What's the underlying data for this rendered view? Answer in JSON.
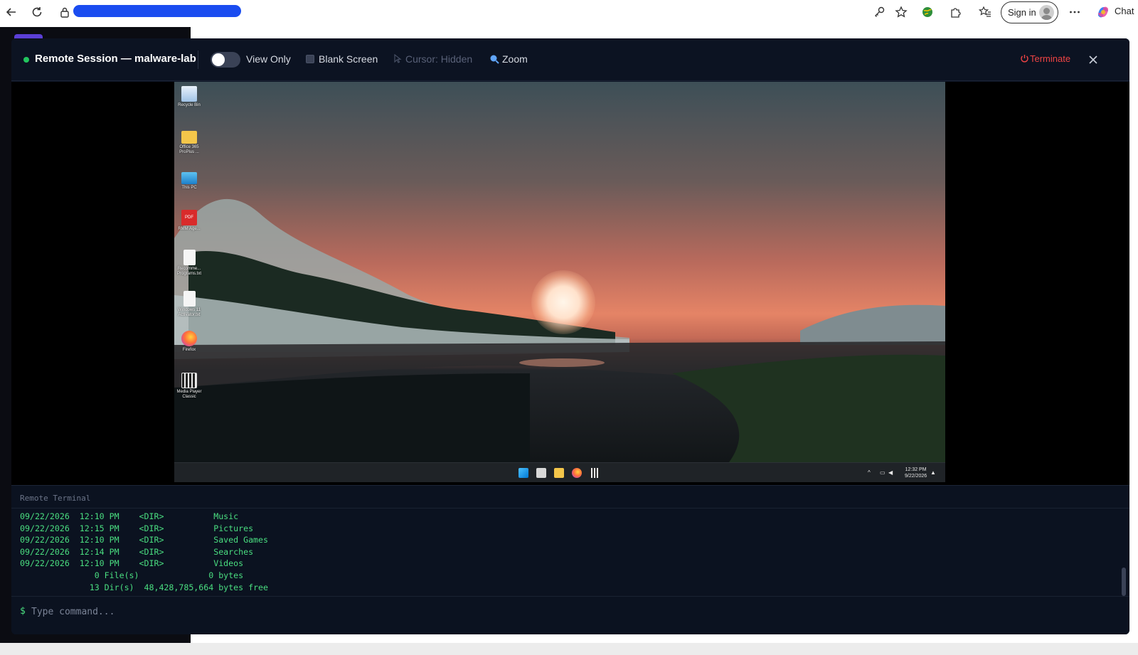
{
  "browser": {
    "sign_in_label": "Sign in",
    "chat_label": "Chat"
  },
  "session": {
    "status_color": "#22c55e",
    "title": "Remote Session — malware-lab",
    "view_only_label": "View Only",
    "view_only_enabled": false,
    "blank_screen_label": "Blank Screen",
    "cursor_label": "Cursor: Hidden",
    "zoom_label": "Zoom",
    "terminate_label": "Terminate",
    "terminate_color": "#ef4444"
  },
  "desktop": {
    "icons": [
      {
        "label": "Recycle Bin",
        "icon": "recycle-bin-icon"
      },
      {
        "label": "Office 365 ProPlus ...",
        "icon": "folder-icon"
      },
      {
        "label": "This PC",
        "icon": "monitor-icon"
      },
      {
        "label": "RMM Age...",
        "icon": "pdf-icon"
      },
      {
        "label": "Recomme... Programs.txt",
        "icon": "text-file-icon"
      },
      {
        "label": "Windows 11 Activator.txt",
        "icon": "text-file-icon"
      },
      {
        "label": "Firefox",
        "icon": "firefox-icon"
      },
      {
        "label": "Media Player Classic",
        "icon": "media-player-icon"
      }
    ],
    "clock_time": "12:32 PM",
    "clock_date": "9/22/2026"
  },
  "terminal": {
    "title": "Remote Terminal",
    "lines": [
      "09/22/2026  12:10 PM    <DIR>          Music",
      "09/22/2026  12:15 PM    <DIR>          Pictures",
      "09/22/2026  12:10 PM    <DIR>          Saved Games",
      "09/22/2026  12:14 PM    <DIR>          Searches",
      "09/22/2026  12:10 PM    <DIR>          Videos",
      "               0 File(s)              0 bytes",
      "              13 Dir(s)  48,428,785,664 bytes free"
    ],
    "prompt": "$",
    "input_placeholder": "Type command..."
  }
}
